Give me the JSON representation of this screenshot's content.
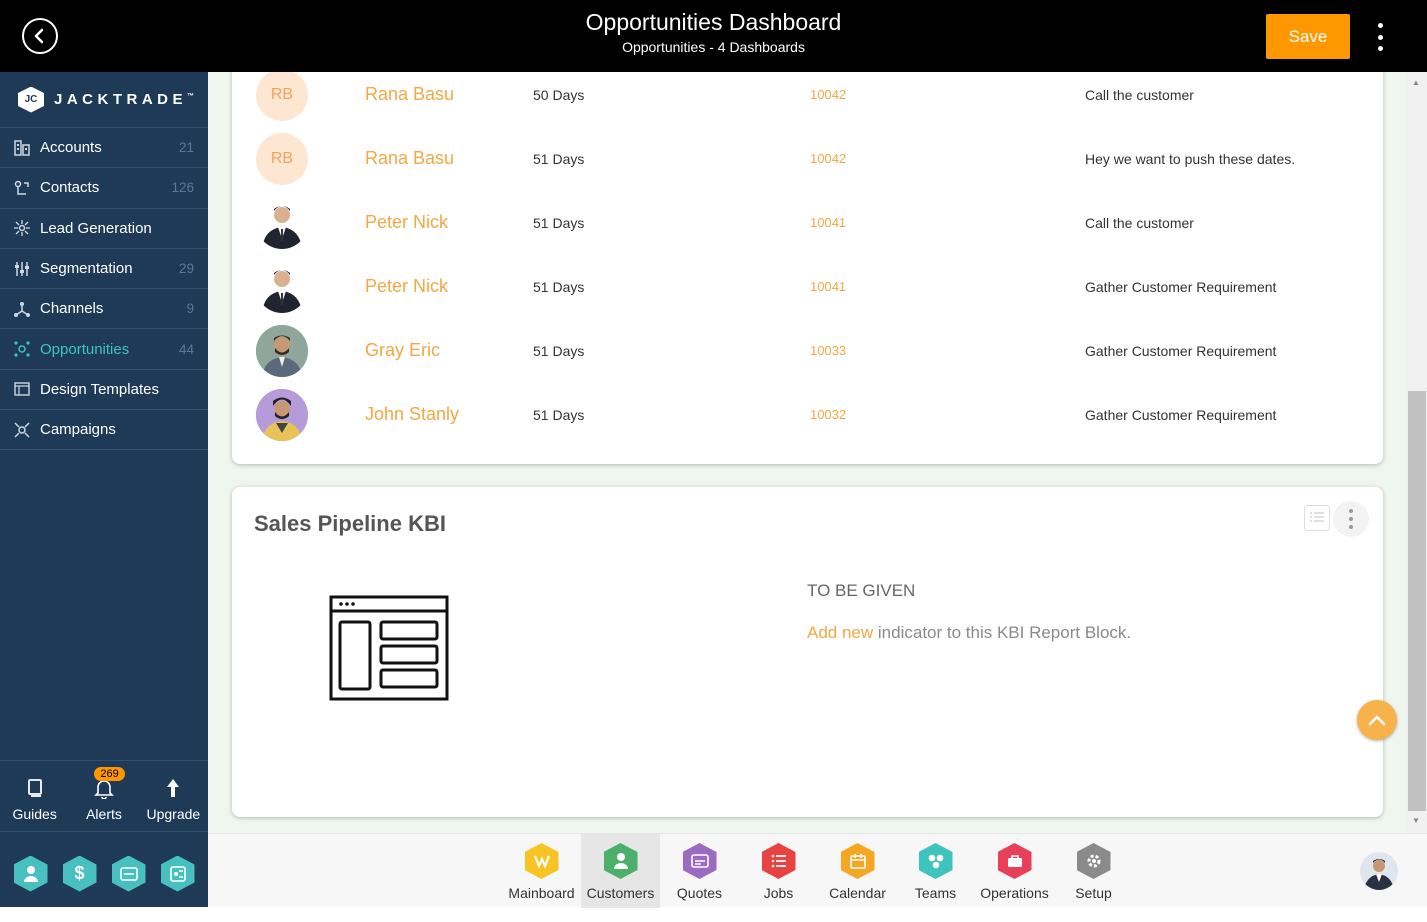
{
  "header": {
    "title": "Opportunities Dashboard",
    "subtitle": "Opportunities - 4 Dashboards",
    "save_label": "Save"
  },
  "sidebar": {
    "brand": "JACKTRADE",
    "brand_mark": "™",
    "items": [
      {
        "label": "Accounts",
        "count": "21",
        "icon": "accounts-icon"
      },
      {
        "label": "Contacts",
        "count": "126",
        "icon": "contacts-icon"
      },
      {
        "label": "Lead Generation",
        "count": "",
        "icon": "lead-generation-icon"
      },
      {
        "label": "Segmentation",
        "count": "29",
        "icon": "segmentation-icon"
      },
      {
        "label": "Channels",
        "count": "9",
        "icon": "channels-icon"
      },
      {
        "label": "Opportunities",
        "count": "44",
        "icon": "opportunities-icon"
      },
      {
        "label": "Design Templates",
        "count": "",
        "icon": "design-templates-icon"
      },
      {
        "label": "Campaigns",
        "count": "",
        "icon": "campaigns-icon"
      }
    ],
    "bottom": {
      "guides": "Guides",
      "alerts": "Alerts",
      "alerts_badge": "269",
      "upgrade": "Upgrade"
    }
  },
  "table": {
    "rows": [
      {
        "initials": "RB",
        "name": "Rana Basu",
        "days": "50 Days",
        "id": "10042",
        "note": "Call the customer"
      },
      {
        "initials": "RB",
        "name": "Rana Basu",
        "days": "51 Days",
        "id": "10042",
        "note": "Hey we want to push these dates."
      },
      {
        "initials": "",
        "name": "Peter Nick",
        "days": "51 Days",
        "id": "10041",
        "note": "Call the customer"
      },
      {
        "initials": "",
        "name": "Peter Nick",
        "days": "51 Days",
        "id": "10041",
        "note": "Gather Customer Requirement"
      },
      {
        "initials": "",
        "name": "Gray Eric",
        "days": "51 Days",
        "id": "10033",
        "note": "Gather Customer Requirement"
      },
      {
        "initials": "",
        "name": "John Stanly",
        "days": "51 Days",
        "id": "10032",
        "note": "Gather Customer Requirement"
      }
    ]
  },
  "kbi": {
    "title": "Sales Pipeline KBI",
    "status": "TO BE GIVEN",
    "add_link": "Add new",
    "add_text": " indicator to this KBI Report Block."
  },
  "bottom_tabs": [
    {
      "label": "Mainboard",
      "color": "#f7c325"
    },
    {
      "label": "Customers",
      "color": "#4caf6a"
    },
    {
      "label": "Quotes",
      "color": "#9b6bc2"
    },
    {
      "label": "Jobs",
      "color": "#e84343"
    },
    {
      "label": "Calendar",
      "color": "#f5a623"
    },
    {
      "label": "Teams",
      "color": "#3ec3bd"
    },
    {
      "label": "Operations",
      "color": "#e8405a"
    },
    {
      "label": "Setup",
      "color": "#8a8a8a"
    }
  ],
  "colors": {
    "accent": "#ff9800",
    "sidebar_bg": "#1e3a56",
    "link": "#f4a742",
    "active_teal": "#3ec3bd"
  }
}
